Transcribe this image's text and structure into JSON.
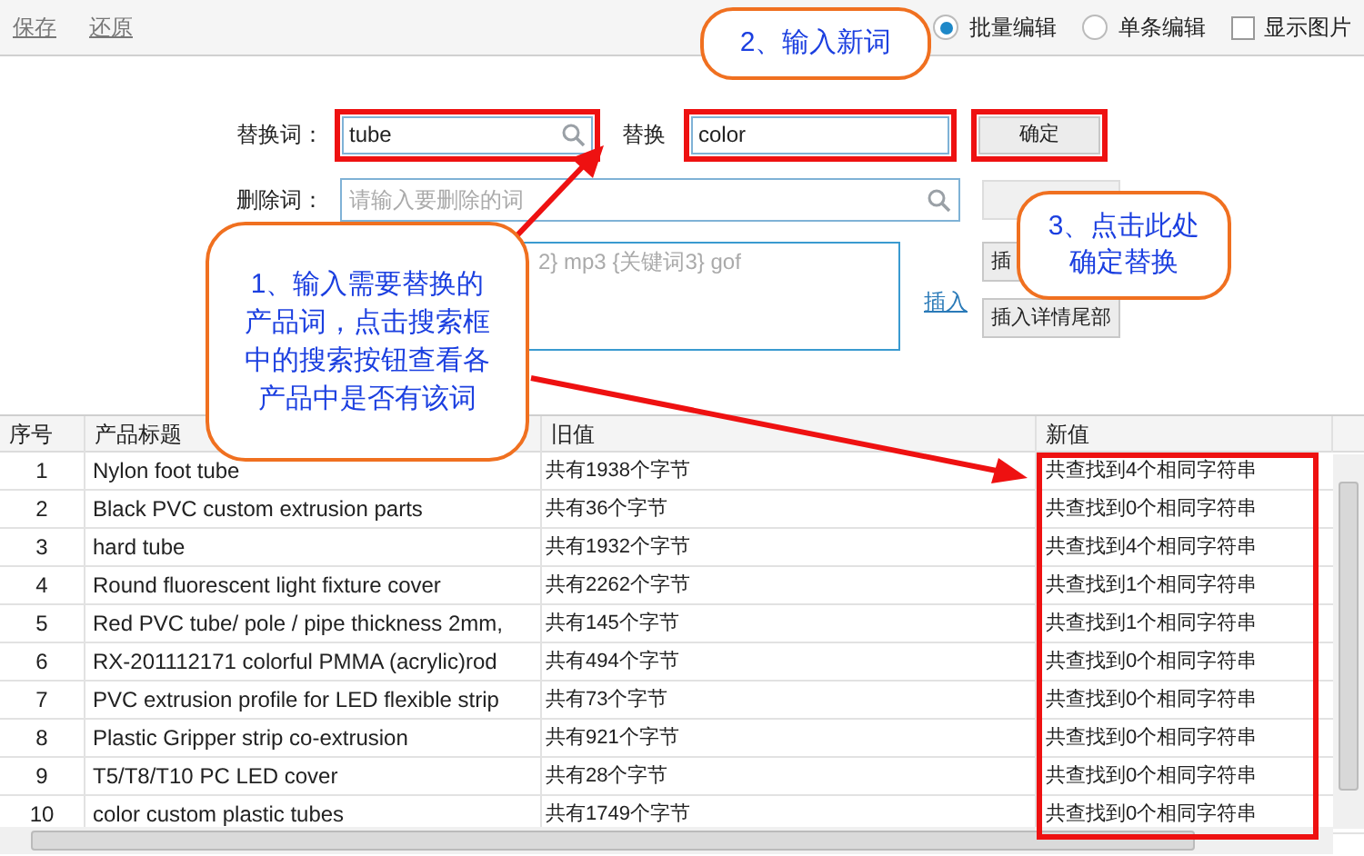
{
  "toolbar": {
    "links": [
      "保存",
      "还原"
    ],
    "modes": [
      {
        "label": "批量编辑",
        "selected": true
      },
      {
        "label": "单条编辑",
        "selected": false
      }
    ],
    "show_images": {
      "label": "显示图片",
      "checked": false
    }
  },
  "form": {
    "replace_label": "替换词：",
    "replace_value": "tube",
    "with_label": "替换",
    "with_value": "color",
    "confirm_button": "确定",
    "delete_label": "删除词：",
    "delete_placeholder": "请输入要删除的词",
    "template_text": "2} mp3 {关键词3} gof",
    "insert_link": "插入",
    "insert_buttons": [
      "插",
      "插入详情尾部"
    ]
  },
  "callouts": [
    "1、输入需要替换的产品词，点击搜索框中的搜索按钮查看各产品中是否有该词",
    "2、输入新词",
    "3、点击此处确定替换"
  ],
  "table": {
    "columns": [
      "序号",
      "产品标题",
      "旧值",
      "新值"
    ],
    "rows": [
      {
        "index": "1",
        "title": "Nylon foot tube",
        "old": "共有1938个字节",
        "new": "共查找到4个相同字符串"
      },
      {
        "index": "2",
        "title": "Black PVC custom extrusion parts",
        "old": "共有36个字节",
        "new": "共查找到0个相同字符串"
      },
      {
        "index": "3",
        "title": "hard tube",
        "old": "共有1932个字节",
        "new": "共查找到4个相同字符串"
      },
      {
        "index": "4",
        "title": "Round fluorescent light fixture cover",
        "old": "共有2262个字节",
        "new": "共查找到1个相同字符串"
      },
      {
        "index": "5",
        "title": "Red PVC tube/ pole / pipe thickness 2mm,",
        "old": "共有145个字节",
        "new": "共查找到1个相同字符串"
      },
      {
        "index": "6",
        "title": "RX-201112171 colorful PMMA (acrylic)rod",
        "old": "共有494个字节",
        "new": "共查找到0个相同字符串"
      },
      {
        "index": "7",
        "title": "PVC extrusion profile for LED flexible strip",
        "old": "共有73个字节",
        "new": "共查找到0个相同字符串"
      },
      {
        "index": "8",
        "title": "Plastic Gripper strip co-extrusion",
        "old": "共有921个字节",
        "new": "共查找到0个相同字符串"
      },
      {
        "index": "9",
        "title": "T5/T8/T10 PC LED cover",
        "old": "共有28个字节",
        "new": "共查找到0个相同字符串"
      },
      {
        "index": "10",
        "title": "color custom plastic tubes",
        "old": "共有1749个字节",
        "new": "共查找到0个相同字符串"
      }
    ]
  }
}
